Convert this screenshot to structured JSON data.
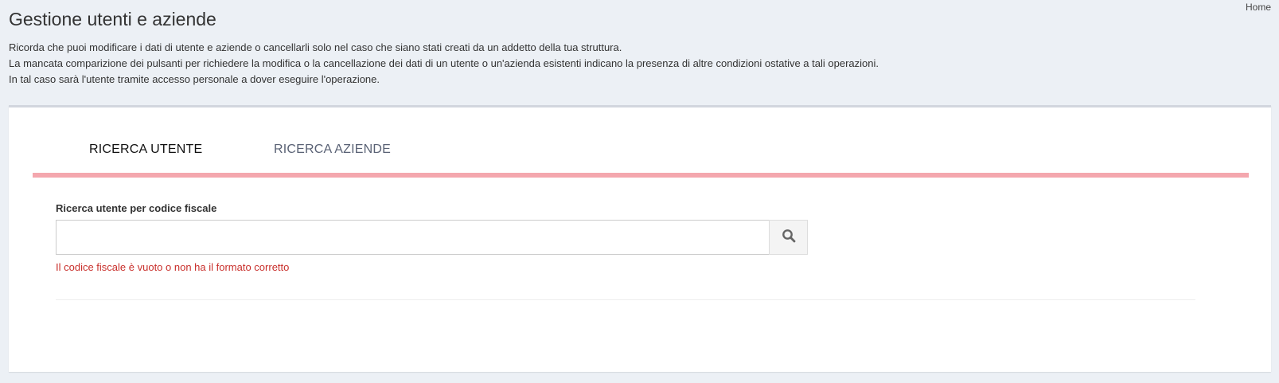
{
  "breadcrumb": {
    "home_label": "Home"
  },
  "page": {
    "title": "Gestione utenti e aziende",
    "intro_lines": [
      "Ricorda che puoi modificare i dati di utente e aziende o cancellarli solo nel caso che siano stati creati da un addetto della tua struttura.",
      "La mancata comparizione dei pulsanti per richiedere la modifica o la cancellazione dei dati di un utente o un'azienda esistenti indicano la presenza di altre condizioni ostative a tali operazioni.",
      "In tal caso sarà l'utente tramite accesso personale a dover eseguire l'operazione."
    ]
  },
  "tabs": [
    {
      "label": "RICERCA UTENTE",
      "active": true
    },
    {
      "label": "RICERCA AZIENDE",
      "active": false
    }
  ],
  "search": {
    "label": "Ricerca utente per codice fiscale",
    "value": "",
    "placeholder": "",
    "button_icon": "search-icon",
    "error": "Il codice fiscale è vuoto o non ha il formato corretto"
  },
  "colors": {
    "tab_underline": "#f4a7ae",
    "error": "#c9302c",
    "background": "#ecf0f5"
  }
}
